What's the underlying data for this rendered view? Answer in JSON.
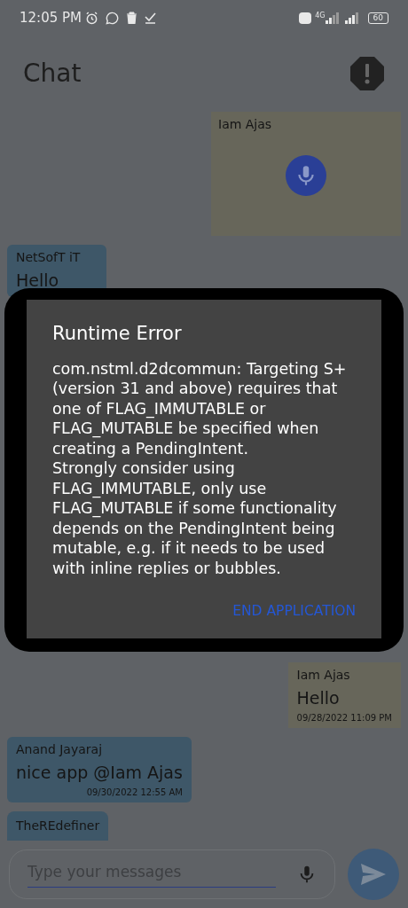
{
  "status_bar": {
    "time": "12:05 PM",
    "network": "4G",
    "battery": "60"
  },
  "header": {
    "title": "Chat"
  },
  "messages": [
    {
      "kind": "voice",
      "mine": true,
      "sender": "Iam Ajas"
    },
    {
      "kind": "text",
      "mine": false,
      "sender": "NetSofT iT",
      "text": "Hello"
    },
    {
      "kind": "gap"
    },
    {
      "kind": "text",
      "mine": true,
      "sender": "Iam Ajas",
      "text": "Hello",
      "time": "09/28/2022 11:09 PM"
    },
    {
      "kind": "text",
      "mine": false,
      "sender": "Anand Jayaraj",
      "text": "nice app @Iam Ajas",
      "time": "09/30/2022 12:55 AM"
    },
    {
      "kind": "cut",
      "mine": false,
      "sender": "TheREdefiner"
    }
  ],
  "composer": {
    "placeholder": "Type your messages"
  },
  "dialog": {
    "title": "Runtime Error",
    "message": "com.nstml.d2dcommun: Targeting S+ (version 31 and above) requires that one of FLAG_IMMUTABLE or FLAG_MUTABLE be specified when creating a PendingIntent.\nStrongly consider using FLAG_IMMUTABLE, only use FLAG_MUTABLE if some functionality depends on the PendingIntent being mutable, e.g. if it needs to be used with inline replies or bubbles.",
    "button": "END APPLICATION"
  }
}
